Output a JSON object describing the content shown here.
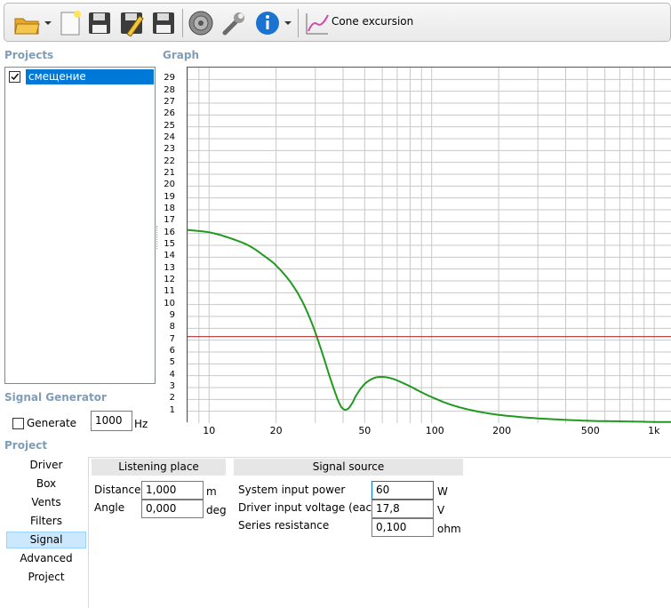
{
  "toolbar": {
    "items": [
      "open-folder-icon",
      "new-file-icon",
      "save-icon",
      "edit-save-icon",
      "save-as-icon",
      "speaker-icon",
      "wrench-icon",
      "info-icon",
      "chart-icon"
    ],
    "graph_type_label": "Cone excursion"
  },
  "projects": {
    "title": "Projects",
    "items": [
      {
        "name": "смещение",
        "checked": true
      }
    ]
  },
  "graph": {
    "title": "Graph"
  },
  "chart_data": {
    "type": "line",
    "x_scale": "log",
    "xlim": [
      8,
      1200
    ],
    "ylim": [
      0,
      30
    ],
    "y_ticks": [
      "1",
      "2",
      "3",
      "4",
      "5",
      "6",
      "7",
      "8",
      "9",
      "10",
      "11",
      "12",
      "13",
      "14",
      "15",
      "16",
      "17",
      "18",
      "19",
      "20",
      "21",
      "22",
      "23",
      "24",
      "25",
      "26",
      "27",
      "28",
      "29"
    ],
    "x_tick_labels": [
      {
        "v": 10,
        "t": "10"
      },
      {
        "v": 20,
        "t": "20"
      },
      {
        "v": 50,
        "t": "50"
      },
      {
        "v": 100,
        "t": "100"
      },
      {
        "v": 200,
        "t": "200"
      },
      {
        "v": 500,
        "t": "500"
      },
      {
        "v": 1000,
        "t": "1k"
      }
    ],
    "grid": true,
    "series": [
      {
        "color": "#1f9a1f",
        "x": [
          8,
          10,
          12,
          15,
          18,
          20,
          23,
          26,
          29,
          32,
          35,
          38,
          40,
          42,
          44,
          46,
          50,
          55,
          60,
          65,
          70,
          80,
          90,
          100,
          120,
          150,
          200,
          300,
          500,
          700,
          1000,
          1200
        ],
        "y": [
          16.3,
          16.1,
          15.7,
          15.0,
          14.0,
          13.3,
          12.0,
          10.4,
          8.4,
          6.1,
          3.8,
          1.9,
          1.2,
          1.2,
          1.7,
          2.4,
          3.3,
          3.8,
          3.9,
          3.8,
          3.6,
          3.1,
          2.6,
          2.2,
          1.6,
          1.1,
          0.7,
          0.4,
          0.2,
          0.15,
          0.1,
          0.1
        ]
      },
      {
        "color": "#b03030",
        "x": [
          8,
          1200
        ],
        "y": [
          7.3,
          7.3
        ]
      }
    ]
  },
  "signal_generator": {
    "title": "Signal Generator",
    "generate_label": "Generate",
    "generate_checked": false,
    "frequency": "1000",
    "frequency_unit": "Hz"
  },
  "project": {
    "title": "Project",
    "tabs": [
      "Driver",
      "Box",
      "Vents",
      "Filters",
      "Signal",
      "Advanced",
      "Project"
    ],
    "active_tab": "Signal"
  },
  "listening_place": {
    "title": "Listening place",
    "distance_label": "Distance",
    "distance_value": "1,000",
    "distance_unit": "m",
    "angle_label": "Angle",
    "angle_value": "0,000",
    "angle_unit": "deg"
  },
  "signal_source": {
    "title": "Signal source",
    "power_label": "System input power",
    "power_value": "60",
    "power_unit": "W",
    "voltage_label": "Driver input voltage (each)",
    "voltage_value": "17,8",
    "voltage_unit": "V",
    "resistance_label": "Series resistance",
    "resistance_value": "0,100",
    "resistance_unit": "ohm"
  }
}
